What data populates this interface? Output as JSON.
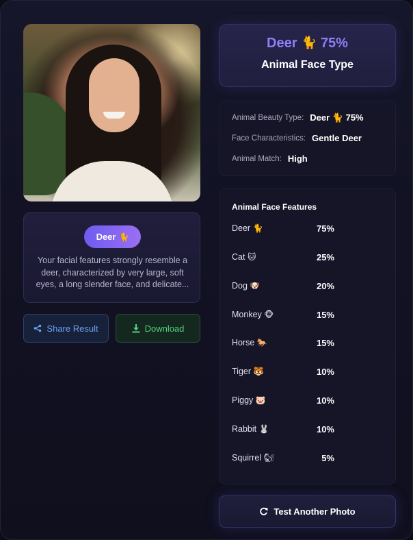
{
  "result": {
    "animal": "Deer",
    "animal_emoji": "🐈",
    "percent": "75%",
    "heading": "Animal Face Type",
    "description": "Your facial features strongly resemble a deer, characterized by very large, soft eyes, a long slender face, and delicate..."
  },
  "info": {
    "beauty_type_label": "Animal Beauty Type:",
    "beauty_type_value": "Deer 🐈 75%",
    "characteristics_label": "Face Characteristics:",
    "characteristics_value": "Gentle Deer",
    "match_label": "Animal Match:",
    "match_value": "High"
  },
  "features": {
    "title": "Animal Face Features",
    "items": [
      {
        "name": "Deer",
        "emoji": "🐈",
        "value": "75%"
      },
      {
        "name": "Cat",
        "emoji": "🐱",
        "value": "25%"
      },
      {
        "name": "Dog",
        "emoji": "🐶",
        "value": "20%"
      },
      {
        "name": "Monkey",
        "emoji": "🐵",
        "value": "15%"
      },
      {
        "name": "Horse",
        "emoji": "🐎",
        "value": "15%"
      },
      {
        "name": "Tiger",
        "emoji": "🐯",
        "value": "10%"
      },
      {
        "name": "Piggy",
        "emoji": "🐷",
        "value": "10%"
      },
      {
        "name": "Rabbit",
        "emoji": "🐰",
        "value": "10%"
      },
      {
        "name": "Squirrel",
        "emoji": "🐿",
        "value": "5%"
      }
    ]
  },
  "buttons": {
    "share_label": "Share Result",
    "download_label": "Download",
    "retest_label": "Test Another Photo"
  },
  "icons": {
    "share": "share-icon",
    "download": "download-icon",
    "refresh": "refresh-icon"
  },
  "colors": {
    "accent": "#8f7ef5",
    "share": "#6aa0f4",
    "download": "#4fd27f"
  }
}
